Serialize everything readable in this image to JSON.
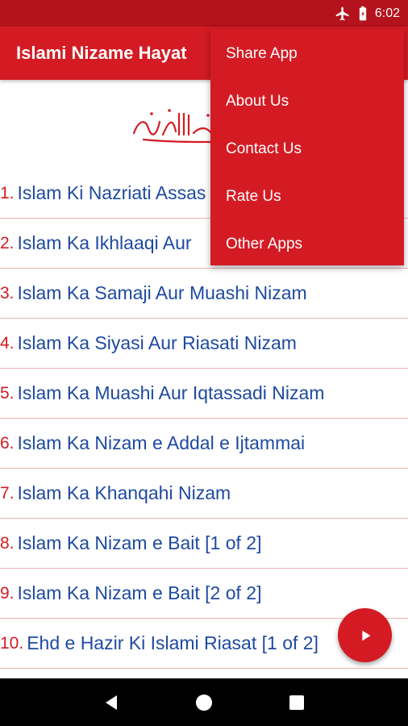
{
  "status_bar": {
    "time": "6:02",
    "icons": [
      "airplane-icon",
      "battery-icon"
    ]
  },
  "app_bar": {
    "title": "Islami Nizame Hayat"
  },
  "colors": {
    "primary": "#d41b24",
    "status_bar": "#b4121c",
    "link_blue": "#1f4aa0",
    "divider": "#f1b3b7"
  },
  "header_graphic": "bismillah-calligraphy",
  "items": [
    {
      "num": "1.",
      "title": "Islam Ki Nazriati Assas"
    },
    {
      "num": "2.",
      "title": "Islam Ka Ikhlaaqi Aur"
    },
    {
      "num": "3.",
      "title": "Islam Ka Samaji Aur Muashi Nizam"
    },
    {
      "num": "4.",
      "title": "Islam Ka Siyasi Aur Riasati Nizam"
    },
    {
      "num": "5.",
      "title": "Islam Ka Muashi Aur Iqtassadi Nizam"
    },
    {
      "num": "6.",
      "title": "Islam Ka Nizam e Addal e Ijtammai"
    },
    {
      "num": "7.",
      "title": "Islam Ka Khanqahi Nizam"
    },
    {
      "num": "8.",
      "title": "Islam Ka Nizam e Bait [1 of 2]"
    },
    {
      "num": "9.",
      "title": "Islam Ka Nizam e Bait [2 of 2]"
    },
    {
      "num": "10.",
      "title": "Ehd e Hazir Ki Islami Riasat [1 of 2]"
    },
    {
      "num": "",
      "title": ""
    }
  ],
  "menu": {
    "items": [
      "Share App",
      "About Us",
      "Contact Us",
      "Rate Us",
      "Other Apps"
    ]
  },
  "fab": {
    "icon": "play-icon"
  },
  "nav_bar": {
    "icons": [
      "back-icon",
      "home-icon",
      "recents-icon"
    ]
  }
}
